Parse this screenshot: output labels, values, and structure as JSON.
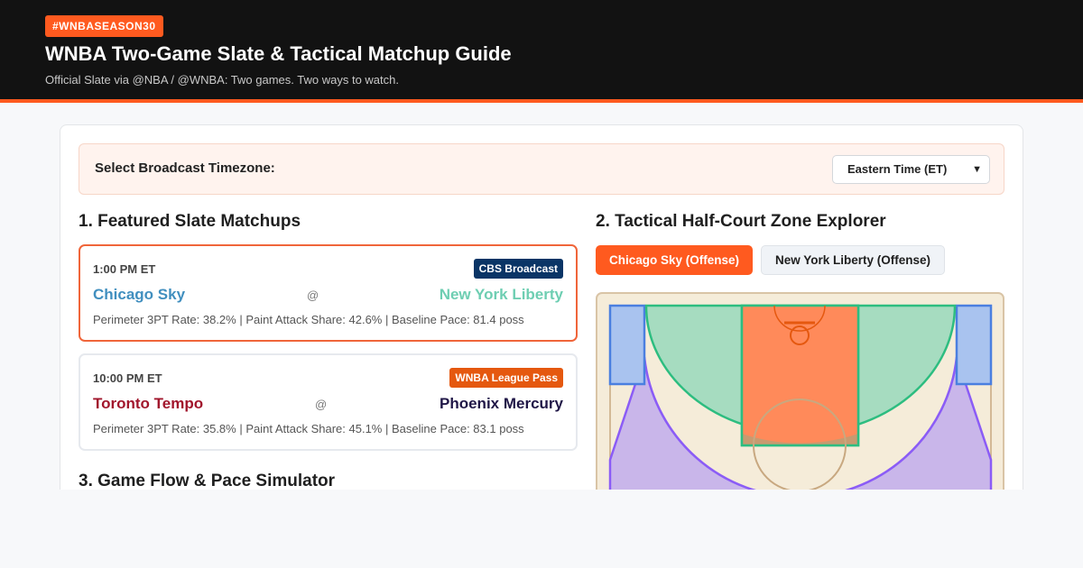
{
  "header": {
    "hashtag": "#WNBASEASON30",
    "title": "WNBA Two-Game Slate & Tactical Matchup Guide",
    "subtitle": "Official Slate via @NBA / @WNBA: Two games. Two ways to watch."
  },
  "timezone": {
    "label": "Select Broadcast Timezone:",
    "selected": "Eastern Time (ET)"
  },
  "sections": {
    "matchups": "1. Featured Slate Matchups",
    "zones": "2. Tactical Half-Court Zone Explorer",
    "simulator": "3. Game Flow & Pace Simulator"
  },
  "games": [
    {
      "time": "1:00 PM ET",
      "network": "CBS Broadcast",
      "network_color": "#0a3566",
      "away": "Chicago Sky",
      "away_color": "#418fbf",
      "at": "@",
      "home": "New York Liberty",
      "home_color": "#6eceb2",
      "stats": "Perimeter 3PT Rate: 38.2% | Paint Attack Share: 42.6% | Baseline Pace: 81.4 poss",
      "selected": true
    },
    {
      "time": "10:00 PM ET",
      "network": "WNBA League Pass",
      "network_color": "#e5580f",
      "away": "Toronto Tempo",
      "away_color": "#a1162c",
      "at": "@",
      "home": "Phoenix Mercury",
      "home_color": "#201747",
      "stats": "Perimeter 3PT Rate: 35.8% | Paint Attack Share: 45.1% | Baseline Pace: 83.1 poss",
      "selected": false
    }
  ],
  "offense_tabs": [
    {
      "label": "Chicago Sky (Offense)",
      "active": true
    },
    {
      "label": "New York Liberty (Offense)",
      "active": false
    }
  ],
  "court_zones": [
    {
      "name": "corner-three",
      "color": "#4a7fe0"
    },
    {
      "name": "paint",
      "color": "#ff7a45"
    },
    {
      "name": "mid-range",
      "color": "#2dbd80"
    },
    {
      "name": "above-break-three",
      "color": "#8b5cf6"
    }
  ],
  "colors": {
    "accent": "#ff5a1f",
    "hero_bg": "#121212"
  }
}
